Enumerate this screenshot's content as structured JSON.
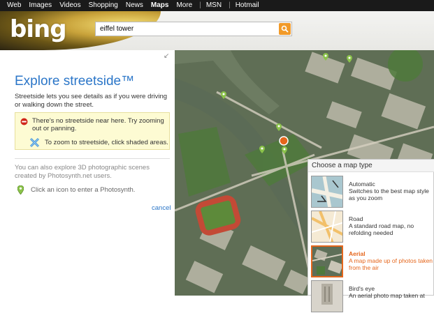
{
  "topnav": {
    "items": [
      "Web",
      "Images",
      "Videos",
      "Shopping",
      "News",
      "Maps",
      "More",
      "MSN",
      "Hotmail"
    ]
  },
  "header": {
    "logo": "bing",
    "search_value": "eiffel tower"
  },
  "panel": {
    "title": "Explore streetside™",
    "description": "Streetside lets you see details as if you were driving or walking down the street.",
    "warning": "There's no streetside near here. Try zooming out or panning.",
    "zoom_hint": "To zoom to streetside, click shaded areas.",
    "photosynth_desc": "You can also explore 3D photographic scenes created by Photosynth.net users.",
    "photosynth_hint": "Click an icon to enter a Photosynth.",
    "cancel": "cancel"
  },
  "map_chooser": {
    "title": "Choose a map type",
    "options": [
      {
        "label": "Automatic",
        "desc": "Switches to the best map style as you zoom",
        "selected": false
      },
      {
        "label": "Road",
        "desc": "A standard road map, no refolding needed",
        "selected": false
      },
      {
        "label": "Aerial",
        "desc": "A map made up of photos taken from the air",
        "selected": true
      },
      {
        "label": "Bird's eye",
        "desc": "An aerial photo map taken at",
        "selected": false
      }
    ]
  },
  "colors": {
    "accent_blue": "#2b76c8",
    "accent_orange": "#e5661c",
    "search_button": "#f19a29",
    "warning_bg": "#fdfbd3"
  }
}
